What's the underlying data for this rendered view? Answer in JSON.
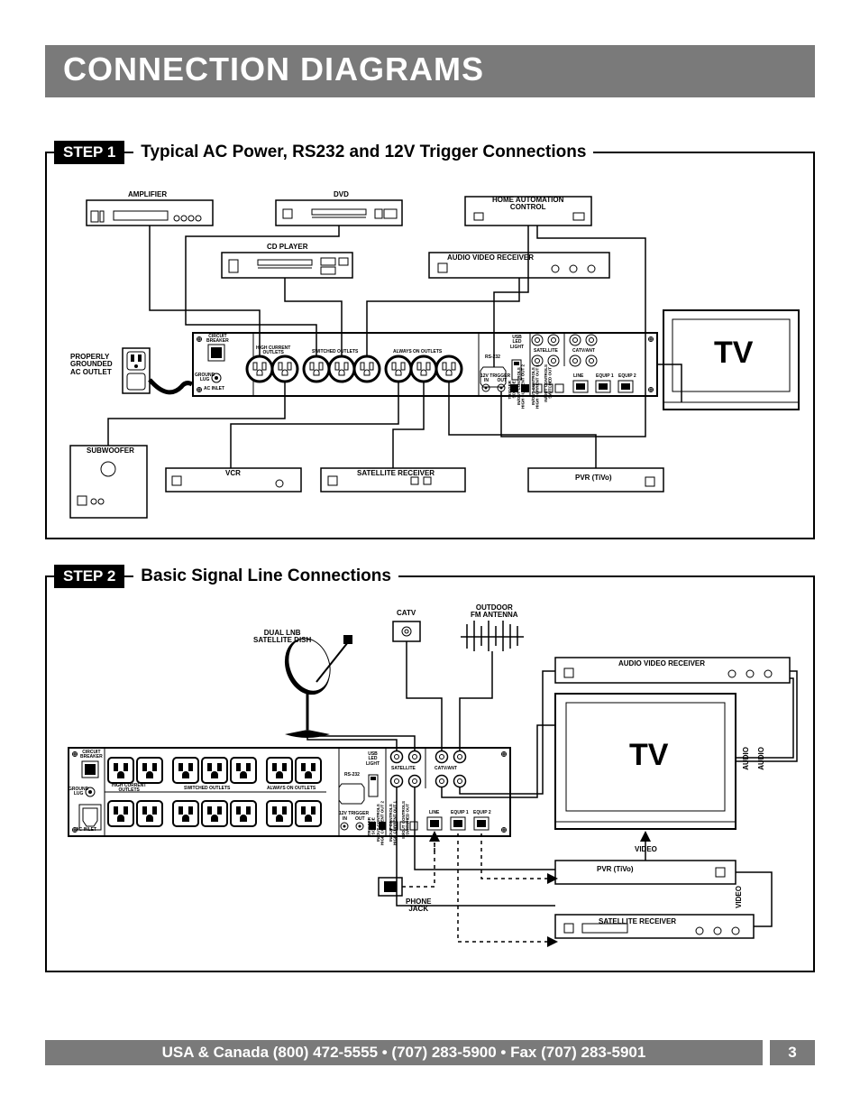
{
  "title": "CONNECTION DIAGRAMS",
  "step1": {
    "badge": "STEP 1",
    "title": "Typical AC Power, RS232 and 12V Trigger Connections",
    "labels": {
      "amplifier": "AMPLIFIER",
      "dvd": "DVD",
      "home_automation": "HOME AUTOMATION\nCONTROL",
      "cd_player": "CD PLAYER",
      "av_receiver": "AUDIO VIDEO RECEIVER",
      "tv": "TV",
      "grounded_outlet": "PROPERLY\nGROUNDED\nAC OUTLET",
      "subwoofer": "SUBWOOFER",
      "vcr": "VCR",
      "sat_receiver": "SATELLITE RECEIVER",
      "pvr": "PVR (TiVo)",
      "circuit_breaker": "CIRCUIT\nBREAKER",
      "ground_lug": "GROUND\nLUG",
      "high_current": "HIGH CURRENT\nOUTLETS",
      "switched": "SWITCHED OUTLETS",
      "always_on": "ALWAYS ON OUTLETS",
      "rs232": "RS-232",
      "usb_led": "USB\nLED\nLIGHT",
      "trigger": "12V TRIGGER",
      "in": "IN",
      "out": "OUT",
      "satellite": "SATELLITE",
      "catv_ant": "CATV/ANT",
      "line": "LINE",
      "equip1": "EQUIP 1",
      "equip2": "EQUIP 2",
      "ac_inlet": "AC INLET",
      "trig_source": "TRIGGER\nSOURCE",
      "hc_out": "IN/OUT CONTROLS\nHIGH CURRENT OUT 2",
      "hc_out2": "IN/OUT CONTROLS\nHIGH CURRENT OUT 1",
      "sw_out": "IN/OUT CONTROLS\nSWITCHED OUT"
    }
  },
  "step2": {
    "badge": "STEP 2",
    "title": "Basic Signal Line Connections",
    "labels": {
      "catv": "CATV",
      "outdoor": "OUTDOOR\nFM ANTENNA",
      "dish": "DUAL LNB\nSATELLITE DISH",
      "av_receiver": "AUDIO VIDEO RECEIVER",
      "tv": "TV",
      "audio": "AUDIO",
      "video": "VIDEO",
      "pvr": "PVR (TiVo)",
      "sat_receiver": "SATELLITE RECEIVER",
      "phone": "PHONE\nJACK",
      "circuit_breaker": "CIRCUIT\nBREAKER",
      "ground_lug": "GROUND\nLUG",
      "high_current": "HIGH CURRENT\nOUTLETS",
      "switched": "SWITCHED OUTLETS",
      "always_on": "ALWAYS ON OUTLETS",
      "rs232": "RS-232",
      "usb_led": "USB\nLED\nLIGHT",
      "trigger": "12V TRIGGER",
      "in": "IN",
      "out": "OUT",
      "satellite": "SATELLITE",
      "catv_ant": "CATV/ANT",
      "line": "LINE",
      "equip1": "EQUIP 1",
      "equip2": "EQUIP 2",
      "ac_inlet": "AC INLET",
      "trig_source": "TRIGGER\nSOURCE",
      "hc_out": "IN/OUT CONTROLS\nHIGH CURRENT OUT 2",
      "hc_out2": "IN/OUT CONTROLS\nHIGH CURRENT OUT 1",
      "sw_out": "IN/OUT CONTROLS\nSWITCHED OUT"
    }
  },
  "footer": {
    "text": "USA & Canada (800) 472-5555  •  (707) 283-5900  •  Fax (707) 283-5901",
    "page": "3"
  }
}
